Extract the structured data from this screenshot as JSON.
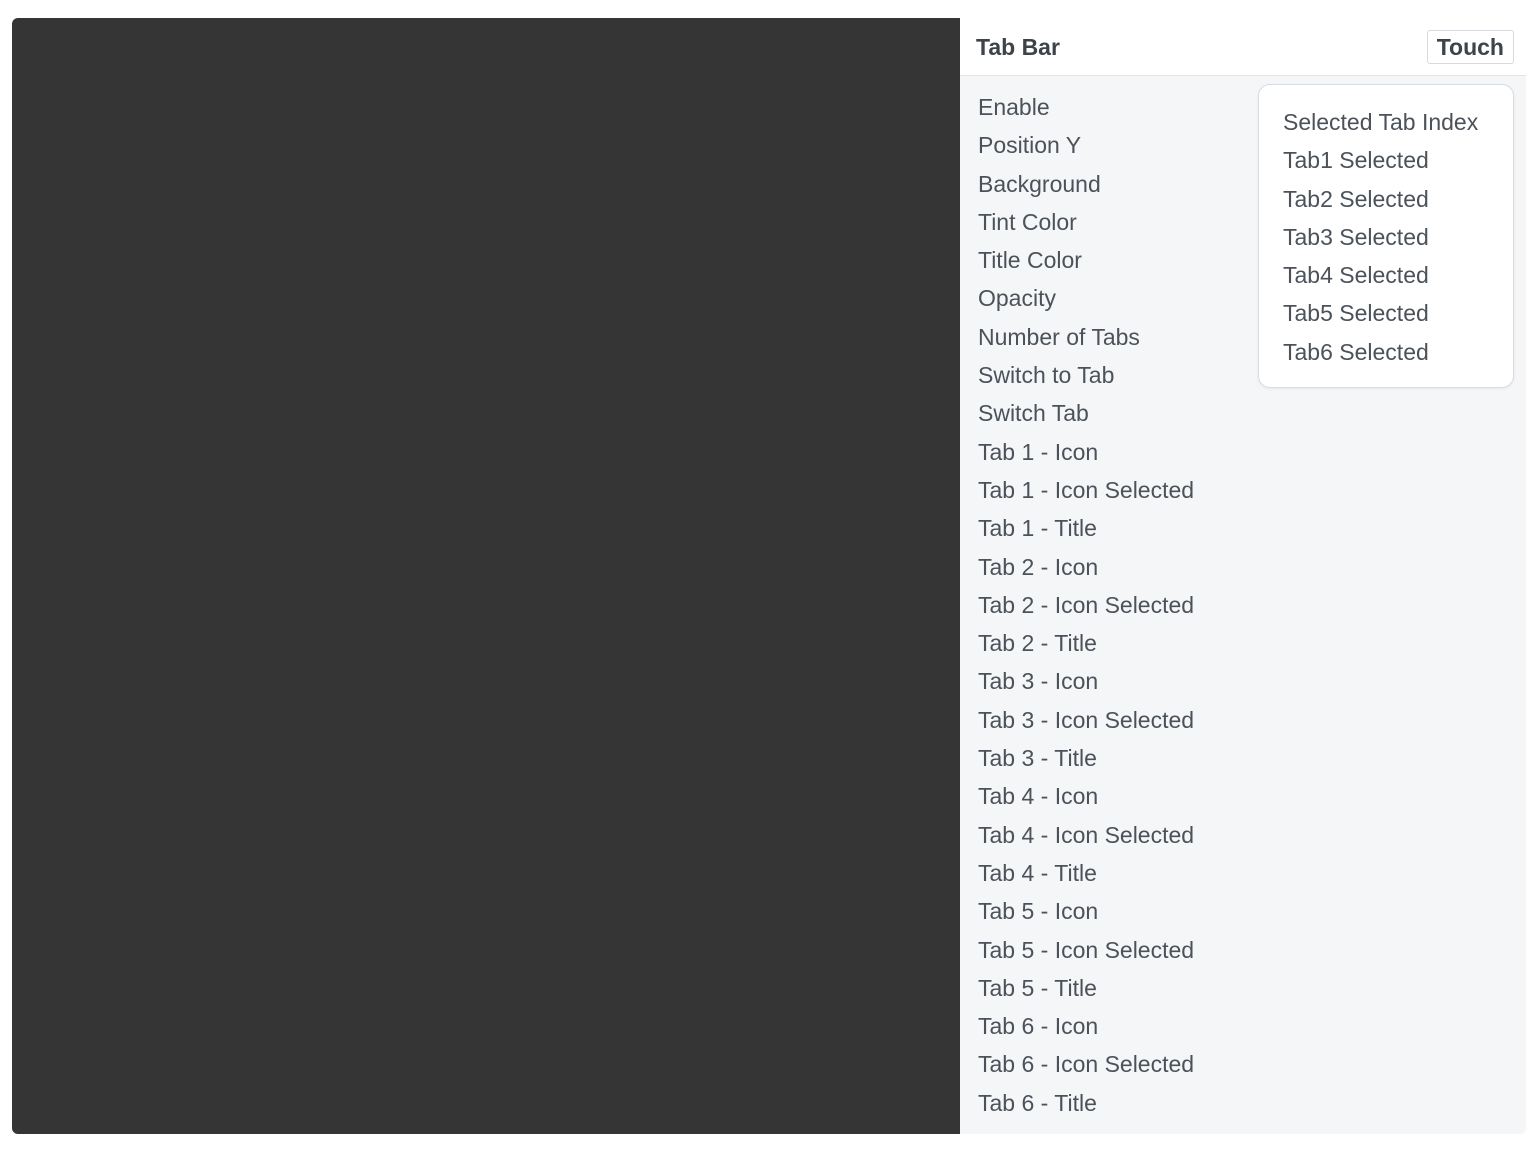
{
  "panel": {
    "title": "Tab Bar",
    "touch_label": "Touch"
  },
  "properties": [
    "Enable",
    "Position Y",
    "Background",
    "Tint Color",
    "Title Color",
    "Opacity",
    "Number of Tabs",
    "Switch to Tab",
    "Switch Tab",
    "Tab 1 - Icon",
    "Tab 1 - Icon Selected",
    "Tab 1 - Title",
    "Tab 2 - Icon",
    "Tab 2 - Icon Selected",
    "Tab 2 - Title",
    "Tab 3 - Icon",
    "Tab 3 - Icon Selected",
    "Tab 3 - Title",
    "Tab 4 - Icon",
    "Tab 4 - Icon Selected",
    "Tab 4 - Title",
    "Tab 5 - Icon",
    "Tab 5 - Icon Selected",
    "Tab 5 - Title",
    "Tab 6 - Icon",
    "Tab 6 - Icon Selected",
    "Tab 6 - Title"
  ],
  "popup": {
    "items": [
      "Selected Tab Index",
      "Tab1 Selected",
      "Tab2 Selected",
      "Tab3 Selected",
      "Tab4 Selected",
      "Tab5 Selected",
      "Tab6 Selected"
    ]
  },
  "colors": {
    "preview_background": "#353535",
    "panel_background": "#f5f6f8",
    "text": "#4b5259"
  }
}
